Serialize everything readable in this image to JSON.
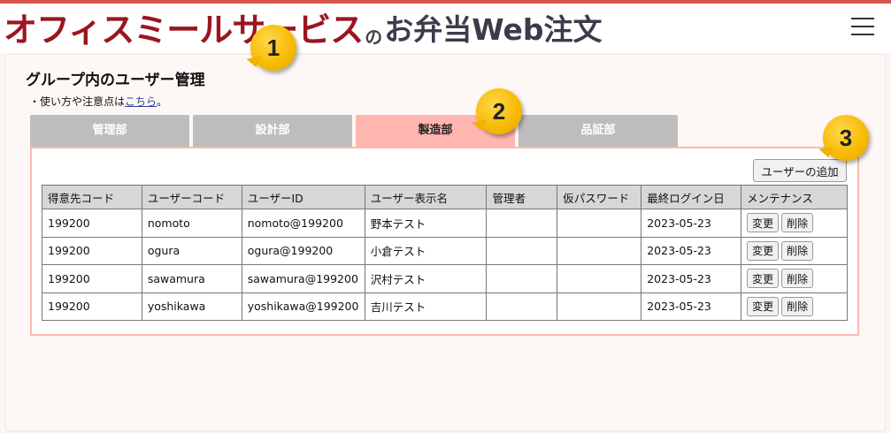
{
  "header": {
    "logo_main": "オフィスミールサービス",
    "logo_no": "の",
    "logo_sub": "お弁当Web注文"
  },
  "page": {
    "title": "グループ内のユーザー管理",
    "note_prefix": "・使い方や注意点は",
    "note_link": "こちら",
    "note_suffix": "。"
  },
  "tabs": [
    {
      "label": "管理部",
      "active": false
    },
    {
      "label": "設計部",
      "active": false
    },
    {
      "label": "製造部",
      "active": true
    },
    {
      "label": "品証部",
      "active": false
    }
  ],
  "add_user_label": "ユーザーの追加",
  "table": {
    "headers": [
      "得意先コード",
      "ユーザーコード",
      "ユーザーID",
      "ユーザー表示名",
      "管理者",
      "仮パスワード",
      "最終ログイン日",
      "メンテナンス"
    ],
    "rows": [
      {
        "customer_code": "199200",
        "user_code": "nomoto",
        "user_id": "nomoto@199200",
        "display_name": "野本テスト",
        "admin": "",
        "temp_password": "",
        "last_login": "2023-05-23"
      },
      {
        "customer_code": "199200",
        "user_code": "ogura",
        "user_id": "ogura@199200",
        "display_name": "小倉テスト",
        "admin": "",
        "temp_password": "",
        "last_login": "2023-05-23"
      },
      {
        "customer_code": "199200",
        "user_code": "sawamura",
        "user_id": "sawamura@199200",
        "display_name": "沢村テスト",
        "admin": "",
        "temp_password": "",
        "last_login": "2023-05-23"
      },
      {
        "customer_code": "199200",
        "user_code": "yoshikawa",
        "user_id": "yoshikawa@199200",
        "display_name": "吉川テスト",
        "admin": "",
        "temp_password": "",
        "last_login": "2023-05-23"
      }
    ],
    "edit_label": "変更",
    "delete_label": "削除"
  },
  "badges": [
    "1",
    "2",
    "3"
  ],
  "icons": {
    "menu": "hamburger-menu-icon"
  },
  "colors": {
    "brand": "#9b1520",
    "accent_line": "#d9534f",
    "active_tab": "#ffb6b1",
    "inactive_tab": "#bdbdbd",
    "badge": "#f7b900"
  }
}
